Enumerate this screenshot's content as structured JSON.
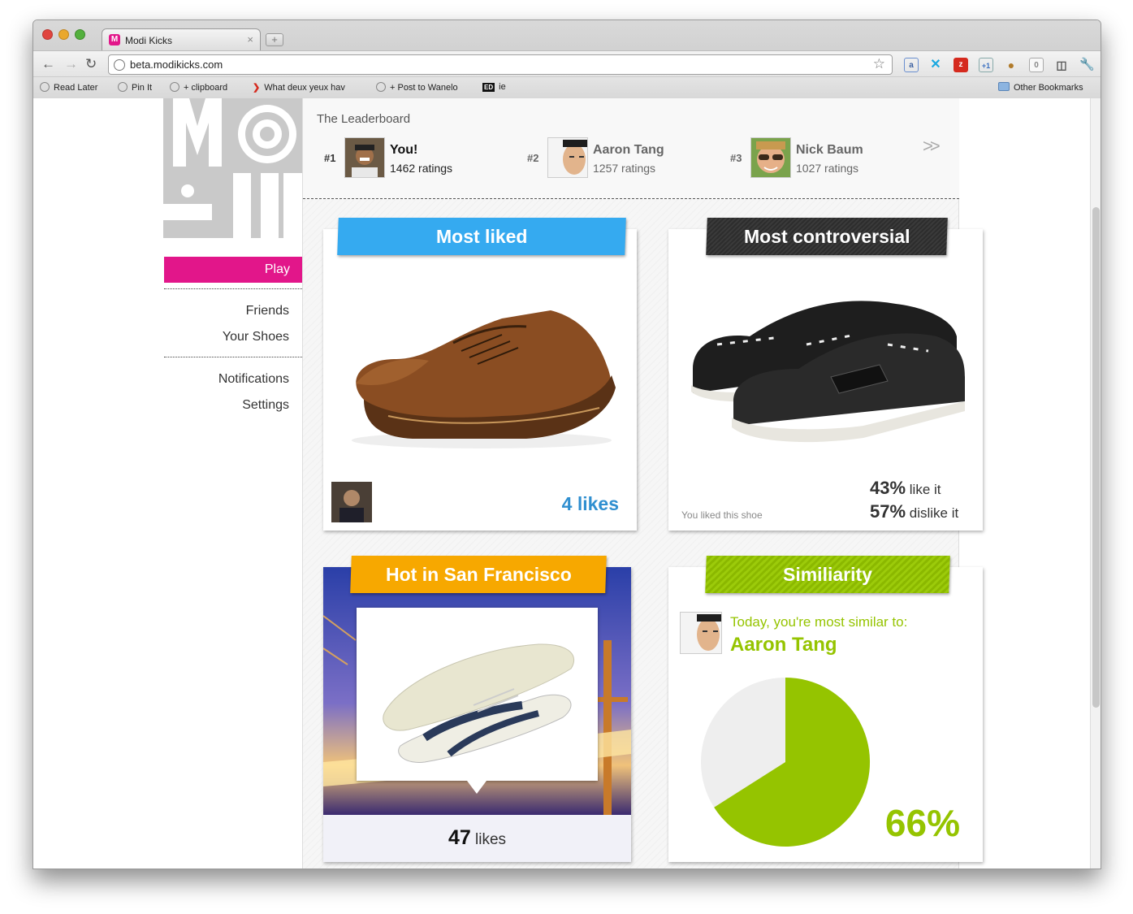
{
  "browser": {
    "tab_title": "Modi Kicks",
    "tab_close": "×",
    "new_tab": "+",
    "url": "beta.modikicks.com",
    "bookmarks": [
      "Read Later",
      "Pin It",
      "+ clipboard",
      "What deux yeux hav",
      "+ Post to Wanelo",
      "ie"
    ],
    "other_bookmarks": "Other Bookmarks",
    "ext_badge_count": "0"
  },
  "sidebar": {
    "play": "Play",
    "items": [
      "Friends",
      "Your Shoes",
      "Notifications",
      "Settings"
    ]
  },
  "leaderboard": {
    "title": "The Leaderboard",
    "entries": [
      {
        "rank": "#1",
        "name": "You!",
        "ratings": "1462 ratings"
      },
      {
        "rank": "#2",
        "name": "Aaron Tang",
        "ratings": "1257 ratings"
      },
      {
        "rank": "#3",
        "name": "Nick Baum",
        "ratings": "1027 ratings"
      }
    ],
    "next": ">>"
  },
  "most_liked": {
    "title": "Most liked",
    "likes": "4 likes"
  },
  "most_controversial": {
    "title": "Most controversial",
    "you_liked": "You liked this shoe",
    "like_pct": "43%",
    "like_label": " like it",
    "dislike_pct": "57%",
    "dislike_label": " dislike it"
  },
  "hot": {
    "title": "Hot in San Francisco",
    "likes_num": "47",
    "likes_label": " likes"
  },
  "similarity": {
    "title": "Similiarity",
    "subtitle": "Today, you're most similar to:",
    "name": "Aaron Tang",
    "percent_label": "66%",
    "percent_value": 66
  },
  "colors": {
    "brand_pink": "#e2168a",
    "liked_blue": "#35aaf0",
    "controversial_dark": "#333333",
    "hot_orange": "#f7a800",
    "similarity_green": "#95c400"
  }
}
